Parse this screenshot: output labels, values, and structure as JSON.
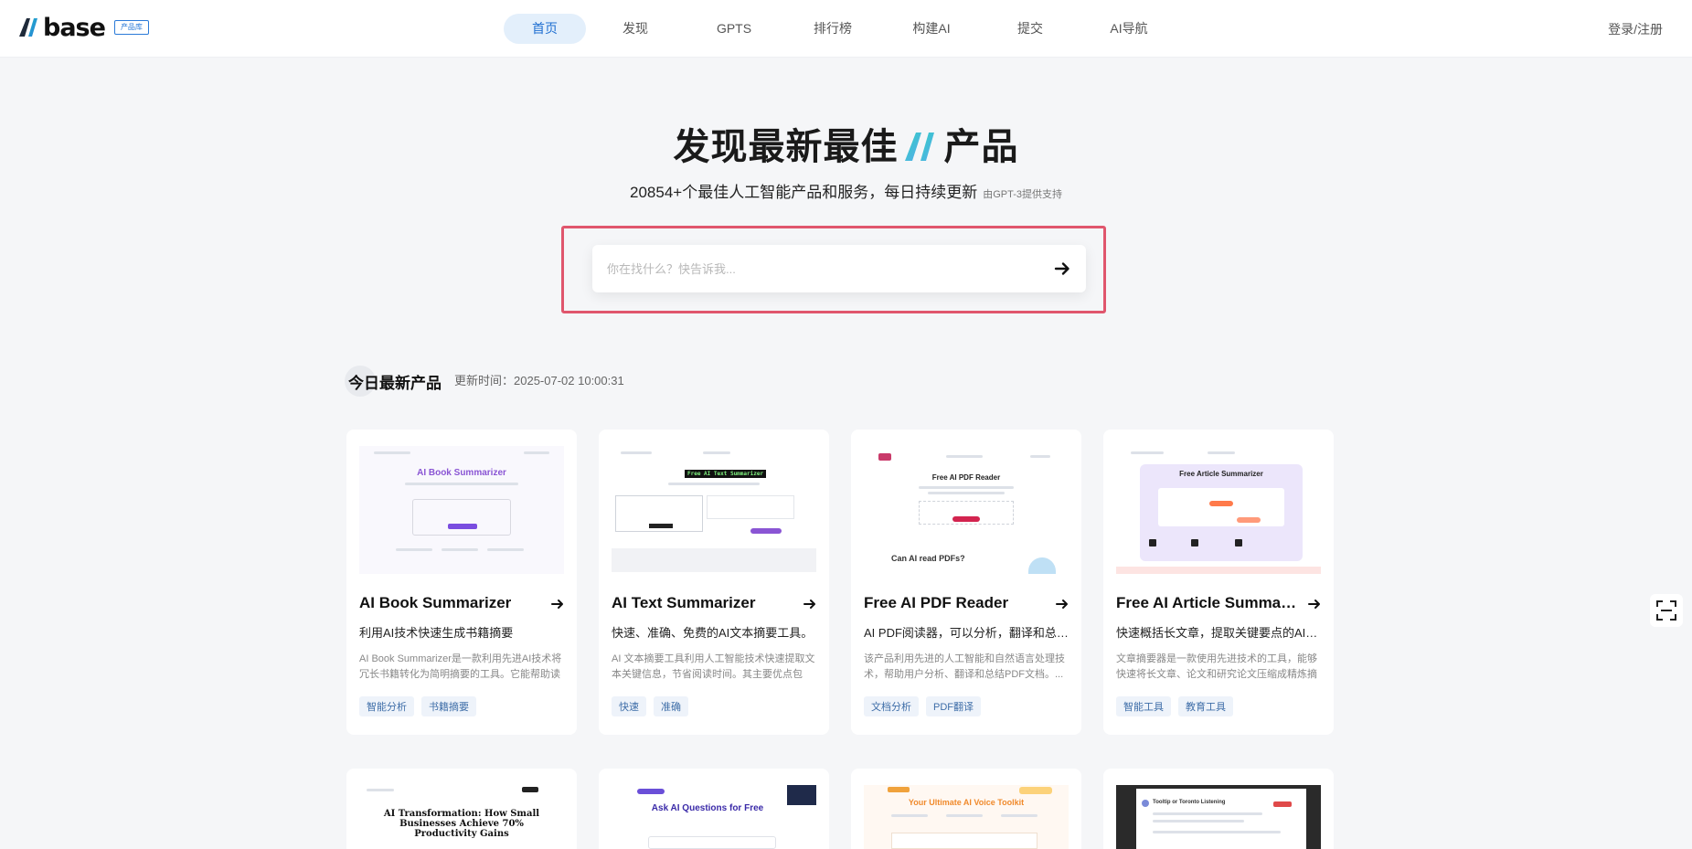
{
  "header": {
    "logo_text": "base",
    "logo_badge": "产品库",
    "nav": [
      {
        "label": "首页",
        "active": true
      },
      {
        "label": "发现",
        "active": false
      },
      {
        "label": "GPTS",
        "active": false
      },
      {
        "label": "排行榜",
        "active": false
      },
      {
        "label": "构建AI",
        "active": false
      },
      {
        "label": "提交",
        "active": false
      },
      {
        "label": "AI导航",
        "active": false
      }
    ],
    "login": "登录/注册"
  },
  "hero": {
    "title_before": "发现最新最佳",
    "title_after": "产品",
    "subtitle": "20854+个最佳人工智能产品和服务，每日持续更新",
    "powered_by": "由GPT-3提供支持"
  },
  "search": {
    "placeholder": "你在找什么？快告诉我..."
  },
  "section": {
    "title": "今日最新产品",
    "updated": "更新时间：2025-07-02 10:00:31"
  },
  "cards": [
    {
      "title": "AI Book Summarizer",
      "tagline": "利用AI技术快速生成书籍摘要",
      "desc": "AI Book Summarizer是一款利用先进AI技术将冗长书籍转化为简明摘要的工具。它能帮助读者快速掌握书籍要点...",
      "tags": [
        "智能分析",
        "书籍摘要"
      ],
      "thumb_title": "AI Book Summarizer"
    },
    {
      "title": "AI Text Summarizer",
      "tagline": "快速、准确、免费的AI文本摘要工具。",
      "desc": "AI 文本摘要工具利用人工智能技术快速提取文本关键信息，节省阅读时间。其主要优点包括...",
      "tags": [
        "快速",
        "准确"
      ],
      "thumb_title": "Free AI Text Summarizer"
    },
    {
      "title": "Free AI PDF Reader",
      "tagline": "AI PDF阅读器，可以分析，翻译和总结PDF文件",
      "desc": "该产品利用先进的人工智能和自然语言处理技术，帮助用户分析、翻译和总结PDF文档。...",
      "tags": [
        "文档分析",
        "PDF翻译"
      ],
      "thumb_title": "Free AI PDF Reader",
      "thumb_sub": "Can AI read PDFs?"
    },
    {
      "title": "Free AI Article Summarizer",
      "tagline": "快速概括长文章，提取关键要点的AI工具",
      "desc": "文章摘要器是一款使用先进技术的工具，能够快速将长文章、论文和研究论文压缩成精炼摘要...",
      "tags": [
        "智能工具",
        "教育工具"
      ],
      "thumb_title": "Free Article Summarizer"
    }
  ],
  "second_row": [
    {
      "thumb_title": "AI Transformation: How Small Businesses Achieve 70% Productivity Gains"
    },
    {
      "thumb_title": "Ask AI Questions for Free"
    },
    {
      "thumb_title": "Your Ultimate AI Voice Toolkit"
    },
    {
      "thumb_title": "Tooltip or Toronto Listening"
    }
  ],
  "colors": {
    "accent": "#1f6fd1",
    "search_frame": "#e0566d",
    "chip_bg": "#eef3fa"
  }
}
